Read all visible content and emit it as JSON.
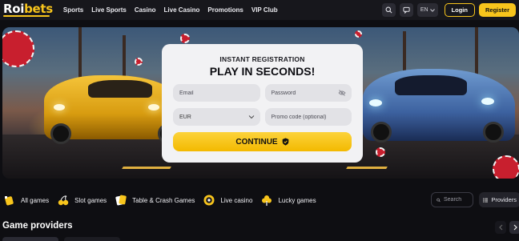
{
  "header": {
    "logo_main": "Roi",
    "logo_accent": "bets",
    "nav": [
      "Sports",
      "Live Sports",
      "Casino",
      "Live Casino",
      "Promotions",
      "VIP Club"
    ],
    "language": "EN",
    "login_label": "Login",
    "register_label": "Register",
    "icons": [
      "search-icon",
      "chat-icon",
      "chevron-down-icon"
    ]
  },
  "registration": {
    "kicker": "INSTANT REGISTRATION",
    "title": "PLAY IN SECONDS!",
    "email_placeholder": "Email",
    "password_placeholder": "Password",
    "currency_value": "EUR",
    "promo_placeholder": "Promo code (optional)",
    "continue_label": "CONTINUE"
  },
  "categories": [
    {
      "label": "All games",
      "icon": "all-games-icon"
    },
    {
      "label": "Slot games",
      "icon": "cherries-icon"
    },
    {
      "label": "Table & Crash Games",
      "icon": "cards-icon"
    },
    {
      "label": "Live casino",
      "icon": "roulette-icon"
    },
    {
      "label": "Lucky games",
      "icon": "clover-icon"
    }
  ],
  "search": {
    "placeholder": "Search"
  },
  "providers_label": "Providers",
  "section": {
    "title": "Game providers"
  },
  "colors": {
    "accent": "#f8c51c",
    "background": "#0e0e12",
    "header": "#17171c",
    "card": "#f2f2f4"
  }
}
